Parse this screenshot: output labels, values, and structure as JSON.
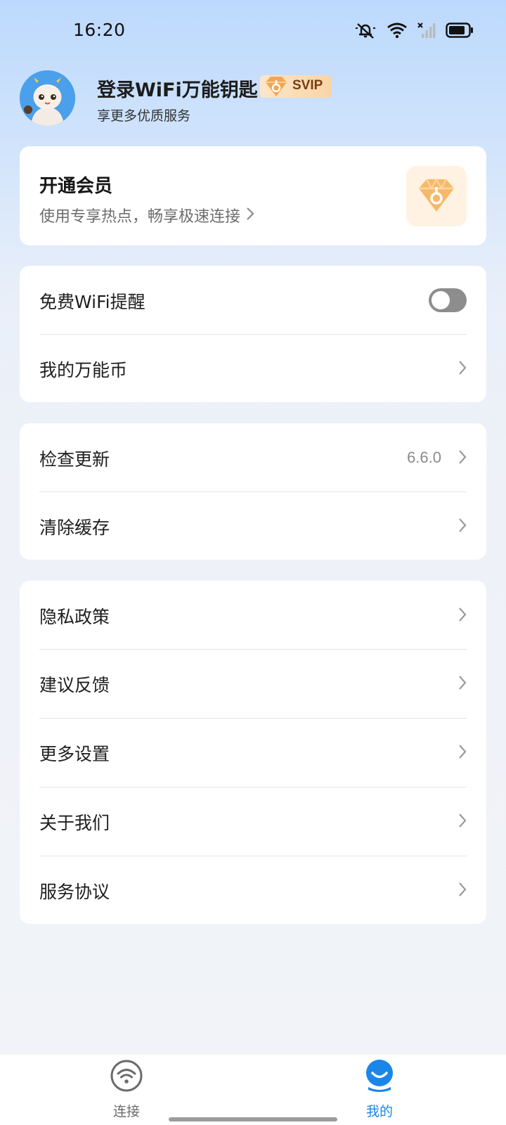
{
  "status_bar": {
    "time": "16:20",
    "icons": [
      "mute-icon",
      "wifi-icon",
      "no-signal-icon",
      "battery-icon"
    ]
  },
  "header": {
    "title": "登录WiFi万能钥匙",
    "badge": "SVIP",
    "subtitle": "享更多优质服务"
  },
  "vip_card": {
    "title": "开通会员",
    "subtitle": "使用专享热点，畅享极速连接",
    "icon": "diamond-key-icon"
  },
  "group1": [
    {
      "label": "免费WiFi提醒",
      "type": "toggle",
      "on": false
    },
    {
      "label": "我的万能币",
      "type": "link"
    }
  ],
  "group2": [
    {
      "label": "检查更新",
      "value": "6.6.0"
    },
    {
      "label": "清除缓存"
    }
  ],
  "group3": [
    {
      "label": "隐私政策"
    },
    {
      "label": "建议反馈"
    },
    {
      "label": "更多设置"
    },
    {
      "label": "关于我们"
    },
    {
      "label": "服务协议"
    }
  ],
  "bottom_nav": [
    {
      "label": "连接",
      "icon": "wifi-icon",
      "active": false
    },
    {
      "label": "我的",
      "icon": "profile-icon",
      "active": true
    }
  ],
  "colors": {
    "accent": "#1a86e8",
    "inactive": "#6b6b6b",
    "vip_orange": "#f3a552"
  }
}
